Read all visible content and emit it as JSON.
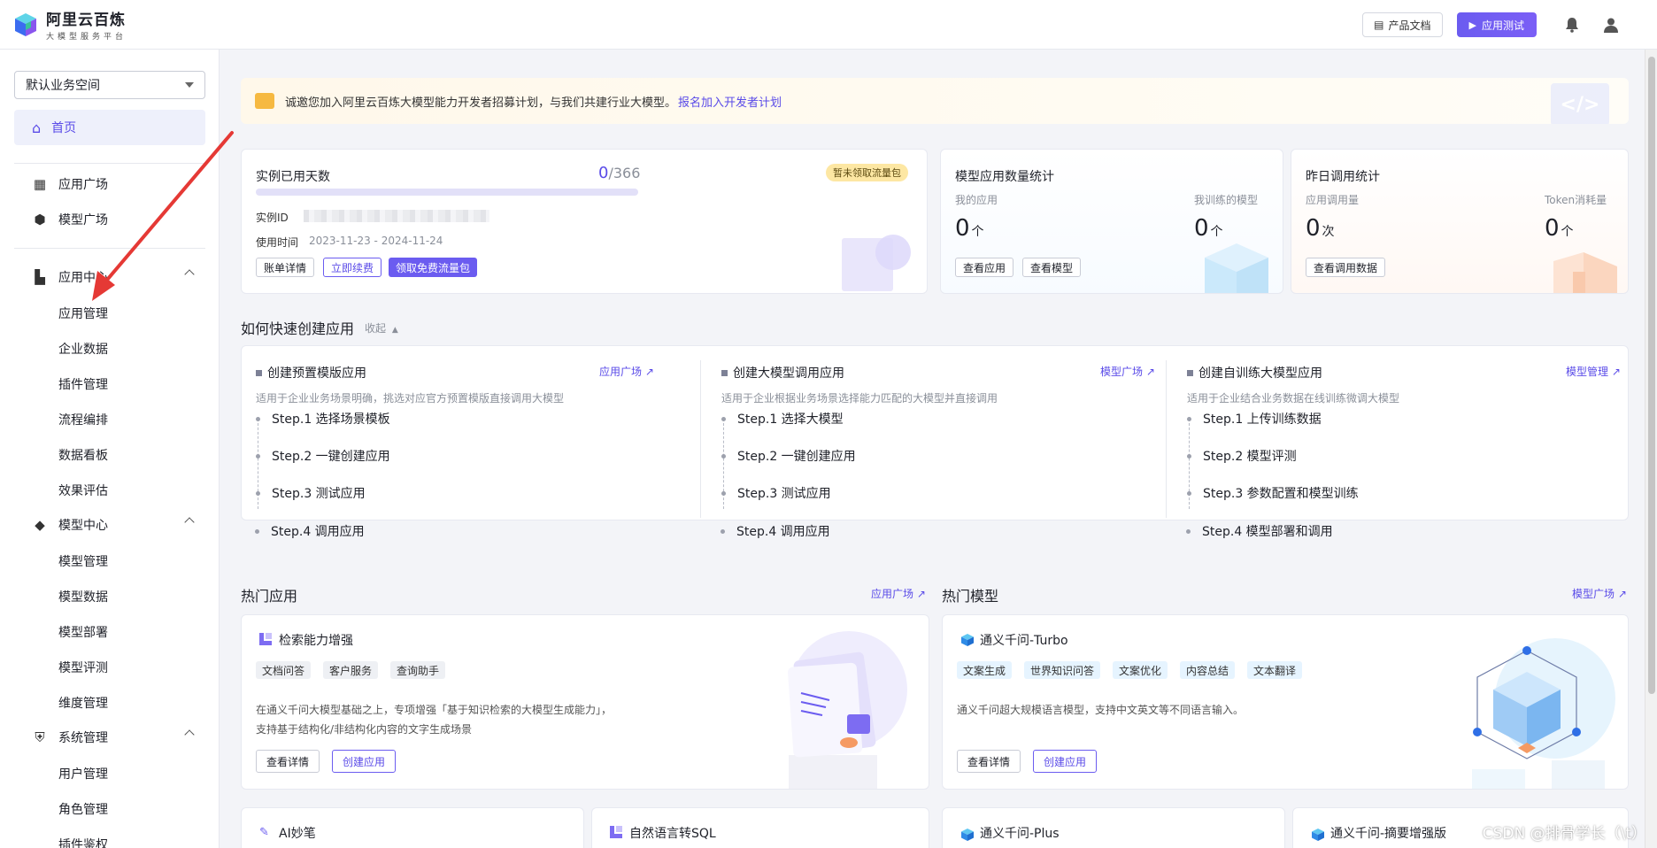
{
  "header": {
    "brand_title": "阿里云百炼",
    "brand_subtitle": "大模型服务平台",
    "doc_button": "产品文档",
    "test_button": "应用测试"
  },
  "sidebar": {
    "workspace": "默认业务空间",
    "home": "首页",
    "items": [
      "应用广场",
      "模型广场"
    ],
    "groups": [
      {
        "label": "应用中心",
        "children": [
          "应用管理",
          "企业数据",
          "插件管理",
          "流程编排",
          "数据看板",
          "效果评估"
        ]
      },
      {
        "label": "模型中心",
        "children": [
          "模型管理",
          "模型数据",
          "模型部署",
          "模型评测",
          "维度管理"
        ]
      },
      {
        "label": "系统管理",
        "children": [
          "用户管理",
          "角色管理",
          "插件鉴权"
        ]
      }
    ]
  },
  "banner": {
    "text": "诚邀您加入阿里云百炼大模型能力开发者招募计划，与我们共建行业大模型。",
    "link": "报名加入开发者计划"
  },
  "instance_card": {
    "title": "实例已用天数",
    "used": "0",
    "total": "/366",
    "progress": 0,
    "badge": "暂未领取流量包",
    "id_label": "实例ID",
    "time_label": "使用时间",
    "time_value": "2023-11-23 - 2024-11-24",
    "btn_bill": "账单详情",
    "btn_renew": "立即续费",
    "btn_claim": "领取免费流量包"
  },
  "model_stats_card": {
    "title": "模型应用数量统计",
    "my_apps_label": "我的应用",
    "my_apps_value": "0",
    "my_apps_unit": "个",
    "trained_label": "我训练的模型",
    "trained_value": "0",
    "trained_unit": "个",
    "btn_apps": "查看应用",
    "btn_models": "查看模型"
  },
  "yesterday_card": {
    "title": "昨日调用统计",
    "calls_label": "应用调用量",
    "calls_value": "0",
    "calls_unit": "次",
    "token_label": "Token消耗量",
    "token_value": "0",
    "token_unit": "个",
    "btn_view": "查看调用数据"
  },
  "quick_create": {
    "title": "如何快速创建应用",
    "collapse": "收起",
    "columns": [
      {
        "title": "创建预置模版应用",
        "link": "应用广场",
        "desc": "适用于企业业务场景明确，挑选对应官方预置模版直接调用大模型",
        "steps": [
          "Step.1 选择场景模板",
          "Step.2 一键创建应用",
          "Step.3 测试应用",
          "Step.4 调用应用"
        ]
      },
      {
        "title": "创建大模型调用应用",
        "link": "模型广场",
        "desc": "适用于企业根据业务场景选择能力匹配的大模型并直接调用",
        "steps": [
          "Step.1 选择大模型",
          "Step.2 一键创建应用",
          "Step.3 测试应用",
          "Step.4 调用应用"
        ]
      },
      {
        "title": "创建自训练大模型应用",
        "link": "模型管理",
        "desc": "适用于企业结合业务数据在线训练微调大模型",
        "steps": [
          "Step.1 上传训练数据",
          "Step.2 模型评测",
          "Step.3 参数配置和模型训练",
          "Step.4 模型部署和调用"
        ]
      }
    ]
  },
  "hot_apps": {
    "title": "热门应用",
    "link": "应用广场",
    "card": {
      "title": "检索能力增强",
      "tags": [
        "文档问答",
        "客户服务",
        "查询助手"
      ],
      "desc_line1": "在通义千问大模型基础之上，专项增强「基于知识检索的大模型生成能力」，",
      "desc_line2": "支持基于结构化/非结构化内容的文字生成场景",
      "btn_detail": "查看详情",
      "btn_create": "创建应用"
    },
    "more": [
      "AI妙笔",
      "自然语言转SQL"
    ]
  },
  "hot_models": {
    "title": "热门模型",
    "link": "模型广场",
    "card": {
      "title": "通义千问-Turbo",
      "tags": [
        "文案生成",
        "世界知识问答",
        "文案优化",
        "内容总结",
        "文本翻译"
      ],
      "desc": "通义千问超大规模语言模型，支持中文英文等不同语言输入。",
      "btn_detail": "查看详情",
      "btn_create": "创建应用"
    },
    "more": [
      "通义千问-Plus",
      "通义千问-摘要增强版"
    ]
  },
  "watermark": "CSDN @排骨学长（\\t）",
  "colors": {
    "accent": "#6b5cf0",
    "arrow": "#e53935"
  }
}
